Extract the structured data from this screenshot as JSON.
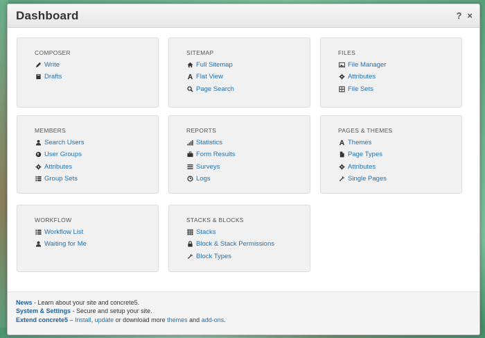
{
  "window": {
    "title": "Dashboard",
    "help_label": "?",
    "close_label": "×"
  },
  "panels": [
    {
      "title": "COMPOSER",
      "items": [
        {
          "label": "Write",
          "icon": "pencil-icon"
        },
        {
          "label": "Drafts",
          "icon": "book-icon"
        }
      ]
    },
    {
      "title": "SITEMAP",
      "items": [
        {
          "label": "Full Sitemap",
          "icon": "home-icon"
        },
        {
          "label": "Flat View",
          "icon": "font-icon"
        },
        {
          "label": "Page Search",
          "icon": "search-icon"
        }
      ]
    },
    {
      "title": "FILES",
      "items": [
        {
          "label": "File Manager",
          "icon": "picture-icon"
        },
        {
          "label": "Attributes",
          "icon": "gear-icon"
        },
        {
          "label": "File Sets",
          "icon": "fileset-icon"
        }
      ]
    },
    {
      "title": "MEMBERS",
      "items": [
        {
          "label": "Search Users",
          "icon": "user-icon"
        },
        {
          "label": "User Groups",
          "icon": "globe-icon"
        },
        {
          "label": "Attributes",
          "icon": "gear-icon"
        },
        {
          "label": "Group Sets",
          "icon": "list-icon"
        }
      ]
    },
    {
      "title": "REPORTS",
      "items": [
        {
          "label": "Statistics",
          "icon": "signal-icon"
        },
        {
          "label": "Form Results",
          "icon": "briefcase-icon"
        },
        {
          "label": "Surveys",
          "icon": "align-icon"
        },
        {
          "label": "Logs",
          "icon": "clock-icon"
        }
      ]
    },
    {
      "title": "PAGES & THEMES",
      "items": [
        {
          "label": "Themes",
          "icon": "font-icon"
        },
        {
          "label": "Page Types",
          "icon": "file-icon"
        },
        {
          "label": "Attributes",
          "icon": "gear-icon"
        },
        {
          "label": "Single Pages",
          "icon": "wrench-icon"
        }
      ]
    },
    {
      "title": "WORKFLOW",
      "items": [
        {
          "label": "Workflow List",
          "icon": "list-icon"
        },
        {
          "label": "Waiting for Me",
          "icon": "user-icon"
        }
      ]
    },
    {
      "title": "STACKS & BLOCKS",
      "items": [
        {
          "label": "Stacks",
          "icon": "grid-icon"
        },
        {
          "label": "Block & Stack Permissions",
          "icon": "lock-icon"
        },
        {
          "label": "Block Types",
          "icon": "wrench-icon"
        }
      ]
    }
  ],
  "footer": {
    "news": {
      "link": "News",
      "text": " - Learn about your site and concrete5."
    },
    "system": {
      "link": "System & Settings",
      "text": " - Secure and setup your site."
    },
    "extend": {
      "link": "Extend concrete5",
      "sep": " – ",
      "install": "Install",
      "comma": ", ",
      "update": "update",
      "mid": " or download more ",
      "themes": "themes",
      "and": " and ",
      "addons": "add-ons",
      "end": "."
    }
  }
}
